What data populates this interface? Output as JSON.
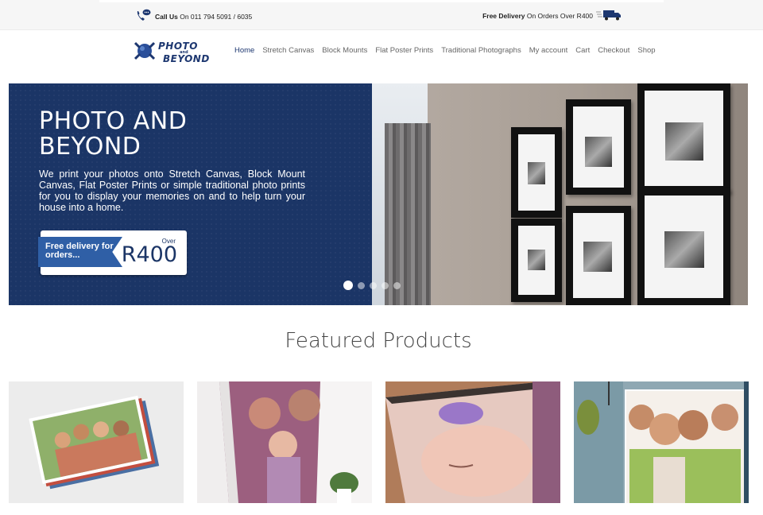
{
  "topbar": {
    "call_label": "Call Us",
    "call_number": "On 011 794 5091 / 6035",
    "delivery_label": "Free Delivery",
    "delivery_text": "On Orders Over R400",
    "phone_icon": "phone-chat-icon",
    "truck_icon": "delivery-truck-icon"
  },
  "logo": {
    "line1": "PHOTO",
    "line2": "and",
    "line3": "BEYOND"
  },
  "nav": {
    "items": [
      {
        "label": "Home",
        "active": true
      },
      {
        "label": "Stretch Canvas"
      },
      {
        "label": "Block Mounts"
      },
      {
        "label": "Flat Poster Prints"
      },
      {
        "label": "Traditional Photographs"
      },
      {
        "label": "My account"
      },
      {
        "label": "Cart"
      },
      {
        "label": "Checkout"
      },
      {
        "label": "Shop"
      }
    ]
  },
  "hero": {
    "title": "PHOTO AND BEYOND",
    "description": "We print your photos onto Stretch Canvas, Block Mount Canvas, Flat Poster Prints or simple traditional photo prints for you to display your memories on and to help turn your house into a home.",
    "badge_flag": "Free delivery for orders...",
    "badge_over": "Over",
    "badge_amount": "R400",
    "slide_count": 5,
    "active_slide": 1
  },
  "featured": {
    "title": "Featured Products"
  },
  "colors": {
    "brand_navy": "#1b3566",
    "nav_active": "#1d3770",
    "badge_blue": "#2f5fa6"
  }
}
